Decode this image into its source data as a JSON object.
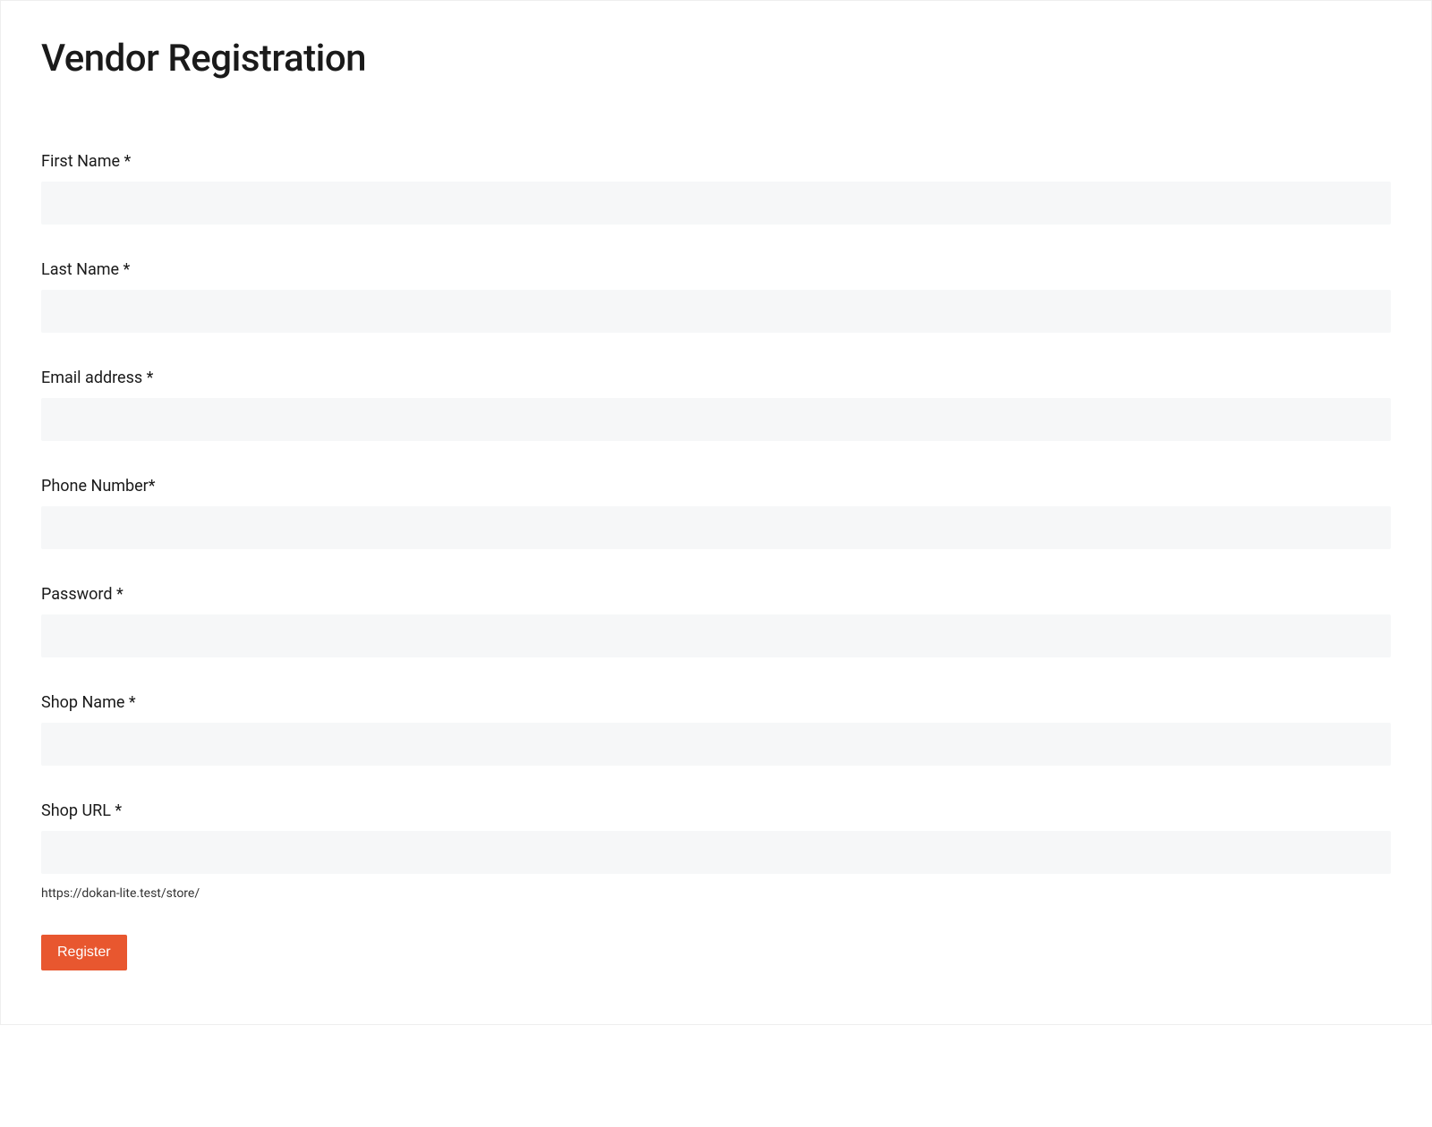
{
  "page": {
    "title": "Vendor Registration"
  },
  "form": {
    "fields": {
      "first_name": {
        "label": "First Name *",
        "value": ""
      },
      "last_name": {
        "label": "Last Name *",
        "value": ""
      },
      "email": {
        "label": "Email address *",
        "value": ""
      },
      "phone": {
        "label": "Phone Number*",
        "value": ""
      },
      "password": {
        "label": "Password *",
        "value": ""
      },
      "shop_name": {
        "label": "Shop Name *",
        "value": ""
      },
      "shop_url": {
        "label": "Shop URL *",
        "value": "",
        "helper": "https://dokan-lite.test/store/"
      }
    },
    "submit_label": "Register"
  }
}
